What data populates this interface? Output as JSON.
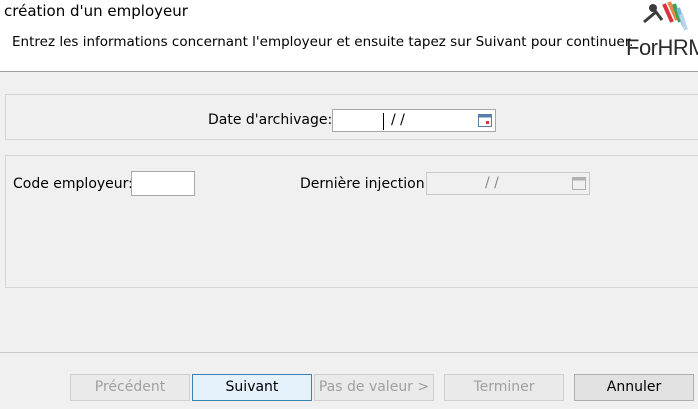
{
  "header": {
    "title": "création d'un employeur",
    "subtitle": "Entrez les informations concernant l'employeur et ensuite tapez sur Suivant pour continuer.",
    "logo_text": "ForHRM"
  },
  "fields": {
    "archive_date": {
      "label": "Date d'archivage:",
      "value": "/ /"
    },
    "employer_code": {
      "label": "Code employeur:",
      "value": ""
    },
    "last_injection": {
      "label": "Dernière injection:",
      "value": "/ /"
    }
  },
  "buttons": {
    "previous": "Précédent",
    "next": "Suivant",
    "no_value": "Pas de valeur >",
    "finish": "Terminer",
    "cancel": "Annuler"
  },
  "colors": {
    "accent": "#3c7fb1",
    "logo_red": "#d9343b",
    "logo_green": "#3aa54a"
  }
}
